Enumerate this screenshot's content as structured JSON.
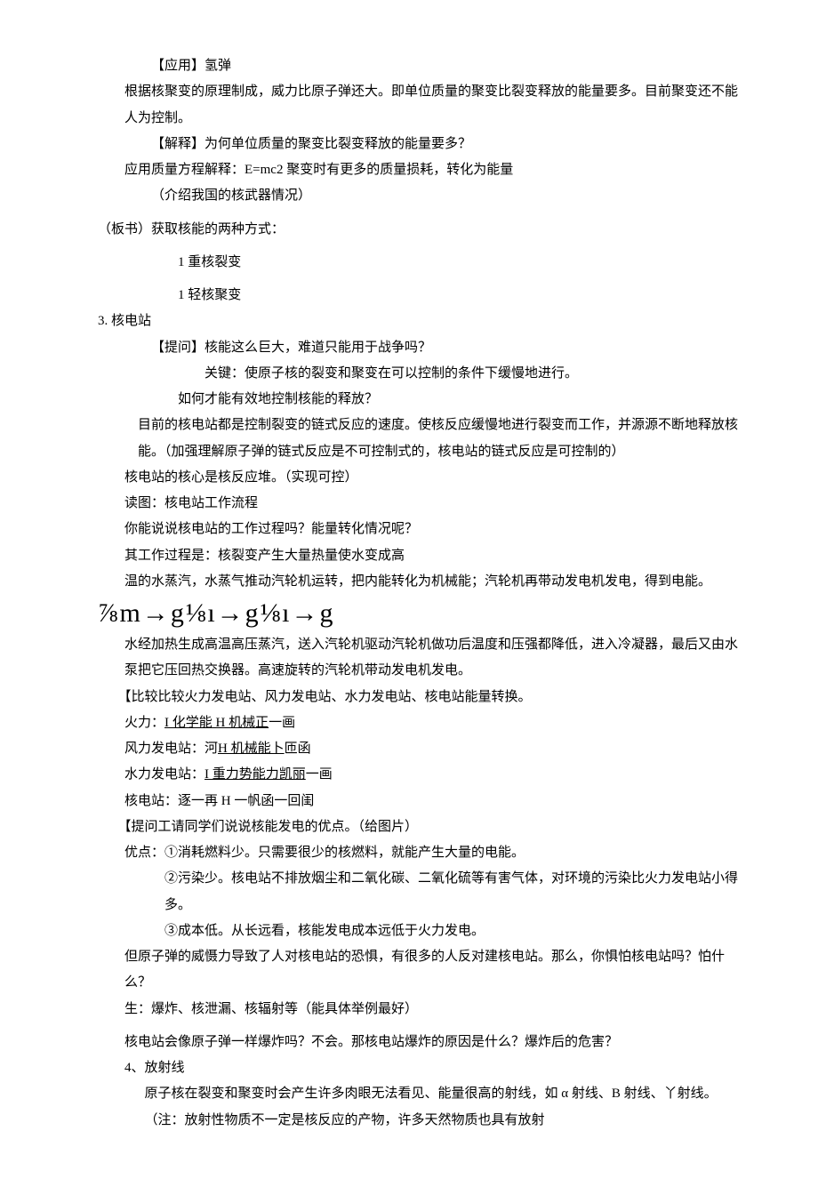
{
  "l1": "【应用】氢弹",
  "l2": "根据核聚变的原理制成，威力比原子弹还大。即单位质量的聚变比裂变释放的能量要多。目前聚变还不能人为控制。",
  "l3": "【解释】为何单位质量的聚变比裂变释放的能量要多？",
  "l4": "应用质量方程解释：E=mc2 聚变时有更多的质量损耗，转化为能量",
  "l5": "（介绍我国的核武器情况）",
  "l6": "（板书）获取核能的两种方式：",
  "l7": "1 重核裂变",
  "l8": "1 轻核聚变",
  "l9": "3. 核电站",
  "l10": "【提问】核能这么巨大，难道只能用于战争吗？",
  "l11": "关键：使原子核的裂变和聚变在可以控制的条件下缓慢地进行。",
  "l12": "如何才能有效地控制核能的释放？",
  "l13": "目前的核电站都是控制裂变的链式反应的速度。使核反应缓慢地进行裂变而工作，并源源不断地释放核能。（加强理解原子弹的链式反应是不可控制式的，核电站的链式反应是可控制的）",
  "l14": "核电站的核心是核反应堆。（实现可控）",
  "l15": "读图：核电站工作流程",
  "l16": "你能说说核电站的工作过程吗？能量转化情况呢？",
  "l17": "其工作过程是：核裂变产生大量热量使水变成高",
  "l18": "温的水蒸汽，水蒸气推动汽轮机运转，把内能转化为机械能；汽轮机再带动发电机发电，得到电能。",
  "l19": "⅞m→g⅛ı→g⅛ı→g",
  "l20": "水经加热生成高温高压蒸汽，送入汽轮机驱动汽轮机做功后温度和压强都降低，进入冷凝器，最后又由水泵把它压回热交换器。高速旋转的汽轮机带动发电机发电。",
  "l21": "【比较比较火力发电站、风力发电站、水力发电站、核电站能量转换。",
  "l22a": "火力：",
  "l22b": "I 化学能 H 机械正",
  "l22c": "一画",
  "l23a": "风力发电站：河",
  "l23b": "H 机械能卜",
  "l23c": "匝函",
  "l24a": "水力发电站：",
  "l24b": "I 重力势能力凯丽",
  "l24c": "一画",
  "l25": "核电站：逐一再 H 一帆函一回闺",
  "l26": "【提问工请同学们说说核能发电的优点。（给图片）",
  "l27": "优点：①消耗燃料少。只需要很少的核燃料，就能产生大量的电能。",
  "l28": "②污染少。核电站不排放烟尘和二氧化碳、二氧化硫等有害气体，对环境的污染比火力发电站小得多。",
  "l29": "③成本低。从长远看，核能发电成本远低于火力发电。",
  "l30": "但原子弹的威慑力导致了人对核电站的恐惧，有很多的人反对建核电站。那么，你惧怕核电站吗？怕什么？",
  "l31": "生：爆炸、核泄漏、核辐射等（能具体举例最好）",
  "l32": "核电站会像原子弹一样爆炸吗？不会。那核电站爆炸的原因是什么？爆炸后的危害？",
  "l33": "4、放射线",
  "l34": "原子核在裂变和聚变时会产生许多肉眼无法看见、能量很高的射线，如 α 射线、B 射线、丫射线。（注：放射性物质不一定是核反应的产物，许多天然物质也具有放射"
}
